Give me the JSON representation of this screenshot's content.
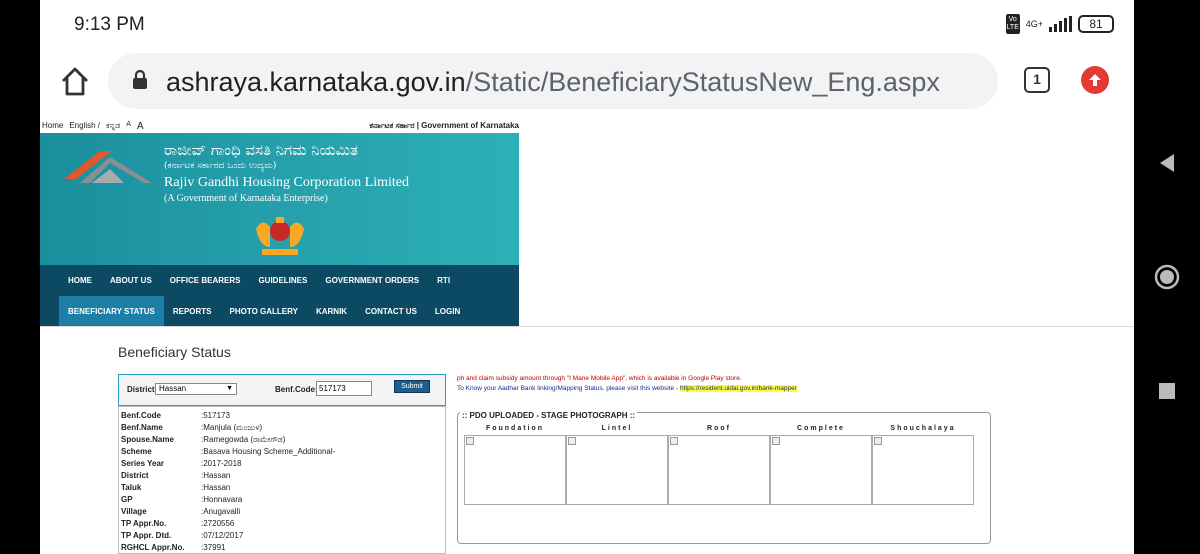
{
  "status_bar": {
    "time": "9:13 PM",
    "volte_label": "VoLTE",
    "network": "4G+",
    "battery": "81"
  },
  "browser": {
    "url_host": "ashraya.karnataka.gov.in",
    "url_path": "/Static/BeneficiaryStatusNew_Eng.aspx",
    "tab_count": "1"
  },
  "topbar": {
    "home": "Home",
    "english": "English /",
    "kannada": "ಕನ್ನಡ",
    "font_a_small": "A",
    "font_a_large": "A",
    "gov": "ಕರ್ನಾಟಕ ಸರ್ಕಾರ | Government of Karnataka"
  },
  "banner": {
    "title_kn": "ರಾಜೀವ್ ಗಾಂಧಿ ವಸತಿ ನಿಗಮ ನಿಯಮಿತ",
    "subtitle_kn": "(ಕರ್ನಾಟಕ ಸರ್ಕಾರದ ಒಂದು ಉದ್ಯಮ)",
    "title_en": "Rajiv Gandhi Housing Corporation Limited",
    "subtitle_en": "(A Government of Karnataka Enterprise)"
  },
  "menu": {
    "row1": [
      "HOME",
      "ABOUT US",
      "OFFICE BEARERS",
      "GUIDELINES",
      "GOVERNMENT ORDERS",
      "RTI"
    ],
    "row2": [
      "BENEFICIARY STATUS",
      "REPORTS",
      "PHOTO GALLERY",
      "KARNIK",
      "CONTACT US",
      "LOGIN"
    ]
  },
  "form": {
    "title": "Beneficiary Status",
    "district_label": "District:",
    "district_value": "Hassan",
    "benf_label": "Benf.Code:",
    "benf_value": "517173",
    "submit": "Submit"
  },
  "details": [
    {
      "k": "Benf.Code",
      "v": ":517173"
    },
    {
      "k": "Benf.Name",
      "v": ":Manjula    (ಮಂಜುಳ)"
    },
    {
      "k": "Spouse.Name",
      "v": ":Ramegowda   (ರಾಮೇಗೌಡ)"
    },
    {
      "k": "Scheme",
      "v": ":Basava Housing Scheme_Additional-"
    },
    {
      "k": "Series Year",
      "v": ":2017-2018"
    },
    {
      "k": "District",
      "v": ":Hassan"
    },
    {
      "k": "Taluk",
      "v": ":Hassan"
    },
    {
      "k": "GP",
      "v": ":Honnavara"
    },
    {
      "k": "Village",
      "v": ":Anugavalli"
    },
    {
      "k": "TP Appr.No.",
      "v": ":2720556"
    },
    {
      "k": "TP Appr. Dtd.",
      "v": ":07/12/2017"
    },
    {
      "k": "RGHCL Appr.No.",
      "v": ":37991"
    }
  ],
  "notice": {
    "line1": "ph and claim subsidy amount through \"I Mane Mobile App\", which is available in Google Play store.",
    "line2_prefix": "To Know your Aadhar Bank linking/Mapping Status, please visit this website - ",
    "line2_link": "https://resident.uidai.gov.in/bank-mapper"
  },
  "photos": {
    "heading": ":: PDO UPLOADED - STAGE PHOTOGRAPH ::",
    "stages": [
      "Foundation",
      "Lintel",
      "Roof",
      "Complete",
      "Shouchalaya"
    ]
  }
}
